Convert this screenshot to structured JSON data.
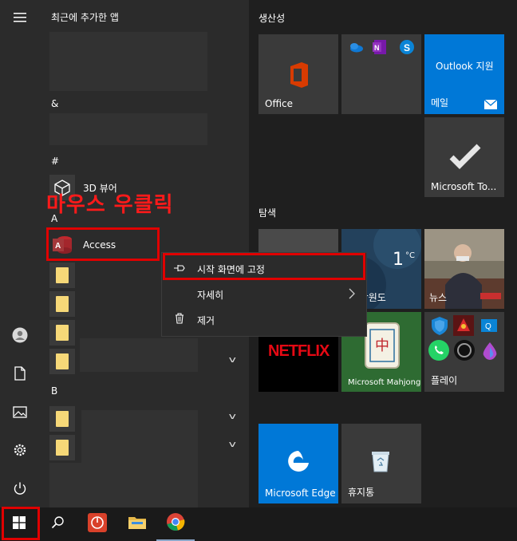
{
  "app_list": {
    "recent_title": "최근에 추가한 앱",
    "letters": {
      "amp": "&",
      "hash": "#",
      "a": "A",
      "b": "B"
    },
    "apps": {
      "viewer_3d": "3D 뷰어",
      "access": "Access"
    }
  },
  "annotation": {
    "text": "마우스 우클릭",
    "color": "#ff1a1a"
  },
  "context_menu": {
    "pin_label": "시작 화면에 고정",
    "more_label": "자세히",
    "uninstall_label": "제거"
  },
  "tiles": {
    "productivity_title": "생산성",
    "explore_title": "탐색",
    "office": "Office",
    "outlook_title": "Outlook 지원",
    "mail": "메일",
    "todo": "Microsoft To...",
    "weather_temp": "1",
    "weather_unit": "°C",
    "weather_loc": "시, 강원도",
    "news": "뉴스",
    "netflix": "NETFLIX",
    "mahjong": "Microsoft Mahjong",
    "play": "플레이",
    "edge": "Microsoft Edge",
    "recycle": "휴지통"
  },
  "colors": {
    "accent_blue": "#0078d7",
    "highlight_red": "#e00000",
    "netflix_red": "#e50914"
  }
}
